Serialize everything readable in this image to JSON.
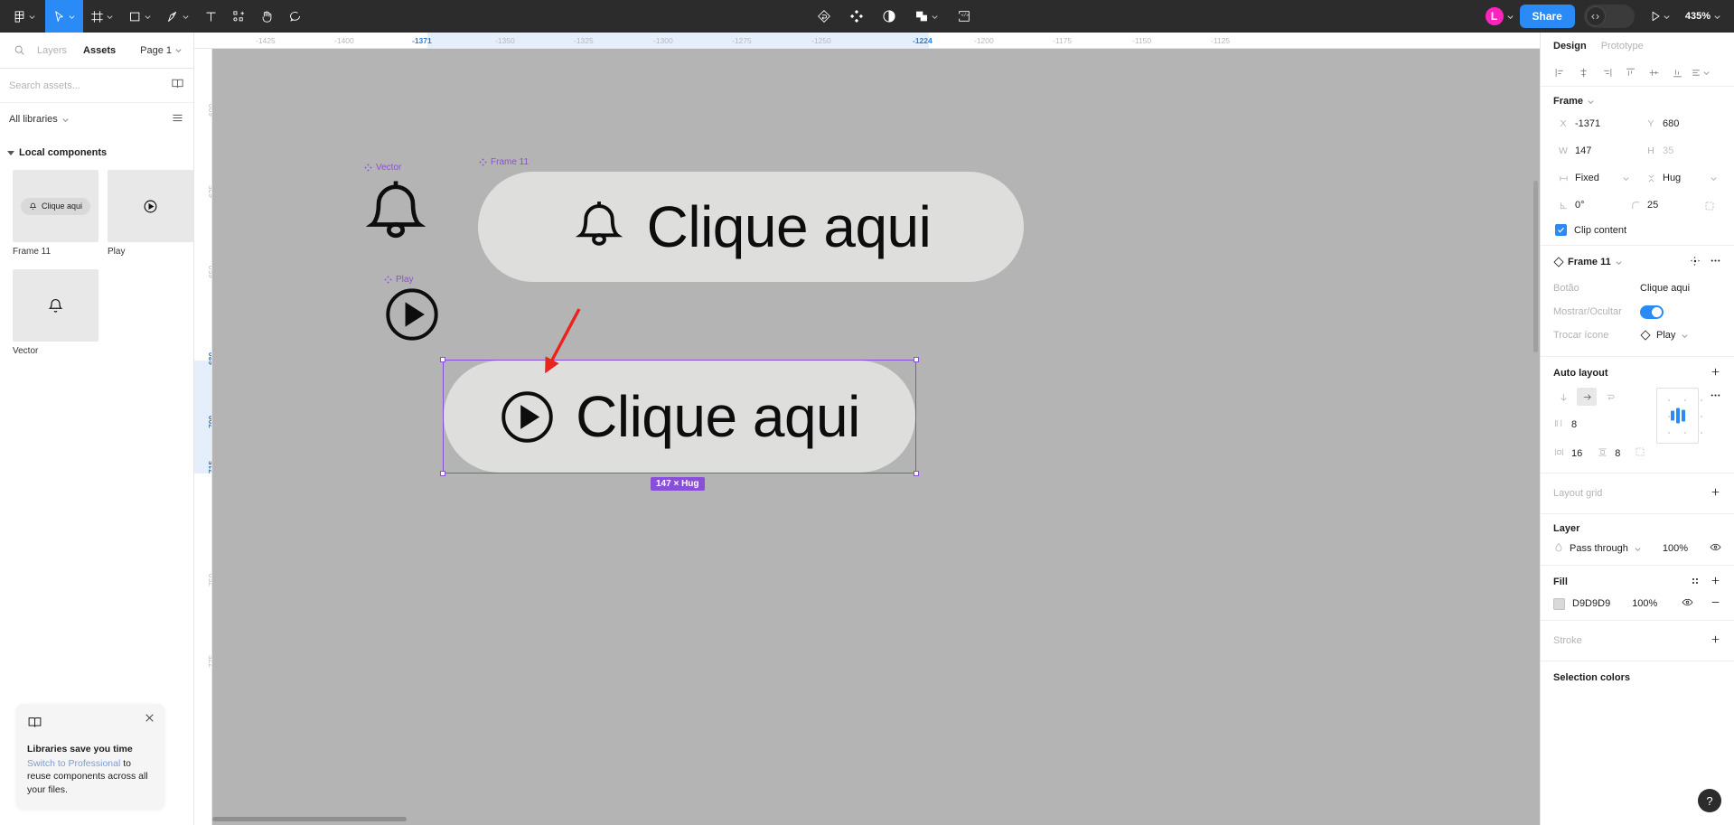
{
  "toolbar": {
    "main_menu_icon": "figma-logo-icon",
    "tools": [
      {
        "name": "move-tool",
        "icon": "cursor-icon",
        "active": true
      },
      {
        "name": "frame-tool",
        "icon": "frame-icon",
        "active": false
      },
      {
        "name": "shape-tool",
        "icon": "square-icon",
        "active": false
      },
      {
        "name": "pen-tool",
        "icon": "pen-icon",
        "active": false
      },
      {
        "name": "text-tool",
        "icon": "text-icon",
        "active": false
      },
      {
        "name": "actions-tool",
        "icon": "sparkle-shapes-icon",
        "active": false
      },
      {
        "name": "hand-tool",
        "icon": "hand-icon",
        "active": false
      },
      {
        "name": "comment-tool",
        "icon": "comment-icon",
        "active": false
      }
    ],
    "center_tools": [
      {
        "name": "prototype-flow-icon"
      },
      {
        "name": "plugins-diamond-icon"
      },
      {
        "name": "contrast-circle-icon"
      },
      {
        "name": "boolean-union-icon"
      },
      {
        "name": "code-frame-icon"
      }
    ],
    "avatar_letter": "L",
    "share_label": "Share",
    "dev_mode_icon": "code-brackets-icon",
    "present_icon": "play-triangle-icon",
    "zoom_level": "435%"
  },
  "left_panel": {
    "tabs": [
      {
        "label": "Layers",
        "active": false
      },
      {
        "label": "Assets",
        "active": true
      }
    ],
    "page_selector": "Page 1",
    "search": {
      "placeholder": "Search assets...",
      "value": ""
    },
    "library_selector": "All libraries",
    "section_title": "Local components",
    "components": [
      {
        "name": "Frame 11",
        "thumb_kind": "pill-button",
        "thumb_label": "Clique aqui",
        "thumb_icon": "bell-icon"
      },
      {
        "name": "Play",
        "thumb_kind": "icon",
        "thumb_icon": "play-circle-icon"
      },
      {
        "name": "Vector",
        "thumb_kind": "icon",
        "thumb_icon": "bell-icon"
      }
    ],
    "promo_card": {
      "icon": "book-icon",
      "title": "Libraries save you time",
      "link_text": "Switch to Professional",
      "body_rest": " to reuse components across all your files.",
      "close_icon": "close-icon"
    }
  },
  "rulers": {
    "horizontal_ticks": [
      "-1425",
      "-1400",
      "-1371",
      "-1350",
      "-1325",
      "-1300",
      "-1275",
      "-1250",
      "-1224",
      "-1200",
      "-1175",
      "-1150",
      "-1125"
    ],
    "horizontal_selected": [
      "-1371",
      "-1224"
    ],
    "vertical_ticks": [
      "600",
      "625",
      "650",
      "680",
      "700",
      "715",
      "750",
      "775"
    ],
    "vertical_selected": [
      "680",
      "700",
      "715"
    ]
  },
  "canvas": {
    "background_color": "#B4B4B4",
    "objects": [
      {
        "label": "Vector",
        "kind": "bell-icon"
      },
      {
        "label": "Play",
        "kind": "play-circle-icon"
      },
      {
        "label": "Frame 11",
        "kind": "pill-button",
        "text": "Clique aqui",
        "icon": "bell-icon",
        "fill": "#DEDEDD"
      },
      {
        "label": "",
        "kind": "pill-button-selected",
        "text": "Clique aqui",
        "icon": "play-circle-icon",
        "fill": "#DEDEDD"
      }
    ],
    "selection_badge": "147 × Hug",
    "annotation_arrow": "red-arrow-annotation"
  },
  "right_panel": {
    "tabs": [
      {
        "label": "Design",
        "active": true
      },
      {
        "label": "Prototype",
        "active": false
      }
    ],
    "align_buttons": [
      "align-left-icon",
      "align-horizontal-center-icon",
      "align-right-icon",
      "align-top-icon",
      "align-vertical-center-icon",
      "align-bottom-icon",
      "distribute-more-icon"
    ],
    "frame": {
      "title": "Frame",
      "x_label": "X",
      "x_value": "-1371",
      "y_label": "Y",
      "y_value": "680",
      "w_label": "W",
      "w_value": "147",
      "h_label": "H",
      "h_value": "35",
      "horizontal_resize": "Fixed",
      "vertical_resize": "Hug",
      "rotation": "0°",
      "corner_radius": "25",
      "independent_corners_icon": "corners-icon",
      "clip_content_label": "Clip content",
      "clip_content_checked": true
    },
    "component": {
      "title": "Frame 11",
      "instance_icon": "component-diamond-icon",
      "swap_icon": "swap-instance-icon",
      "more_icon": "more-dots-icon",
      "properties": [
        {
          "name": "Botão",
          "type": "text",
          "value": "Clique aqui"
        },
        {
          "name": "Mostrar/Ocultar",
          "type": "toggle",
          "value": true
        },
        {
          "name": "Trocar ícone",
          "type": "instance",
          "value": "Play"
        }
      ]
    },
    "auto_layout": {
      "title": "Auto layout",
      "add_icon": "plus-icon",
      "more_icon": "more-dots-icon",
      "direction_vertical_icon": "arrow-down-icon",
      "direction_horizontal_icon": "arrow-right-icon",
      "direction_wrap_icon": "wrap-icon",
      "active_direction": "horizontal",
      "gap_label_icon": "gap-icon",
      "gap_value": "8",
      "padding_h_icon": "horizontal-padding-icon",
      "padding_h_value": "16",
      "padding_v_icon": "vertical-padding-icon",
      "padding_v_value": "8",
      "advanced_icon": "advanced-layout-icon"
    },
    "layout_grid": {
      "title": "Layout grid",
      "add_icon": "plus-icon"
    },
    "layer": {
      "title": "Layer",
      "blend_icon": "blend-drop-icon",
      "blend_mode": "Pass through",
      "opacity": "100%",
      "visibility_icon": "eye-icon"
    },
    "fill": {
      "title": "Fill",
      "styles_icon": "styles-grid-icon",
      "add_icon": "plus-icon",
      "items": [
        {
          "swatch": "#D9D9D9",
          "hex": "D9D9D9",
          "opacity": "100%",
          "visibility_icon": "eye-icon",
          "remove_icon": "minus-icon"
        }
      ]
    },
    "stroke": {
      "title": "Stroke",
      "add_icon": "plus-icon"
    },
    "selection_colors": {
      "title": "Selection colors"
    },
    "help_button": "?"
  }
}
